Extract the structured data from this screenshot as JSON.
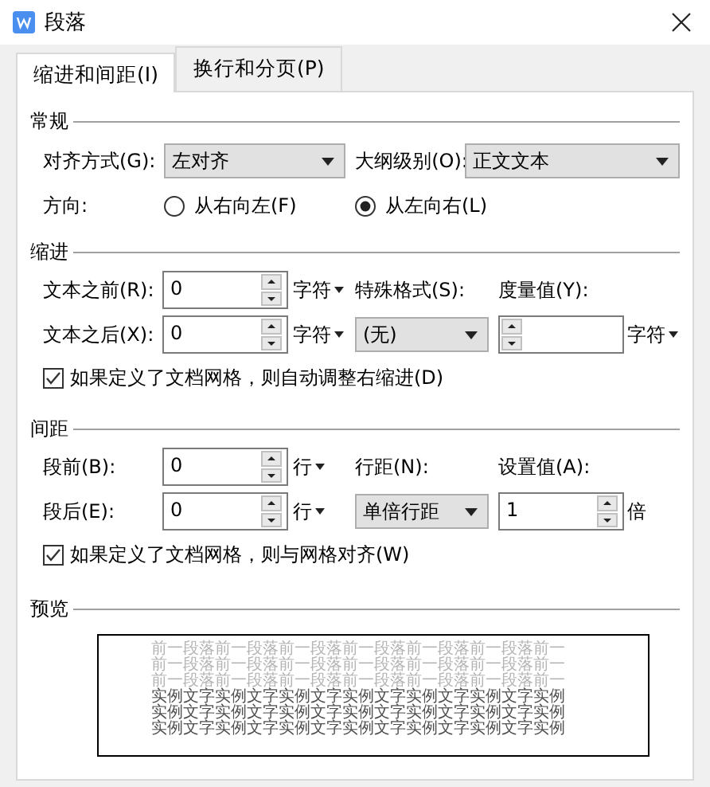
{
  "window": {
    "title": "段落"
  },
  "tabs": [
    {
      "label": "缩进和间距(I)",
      "selected": true
    },
    {
      "label": "换行和分页(P)",
      "selected": false
    }
  ],
  "general": {
    "heading": "常规",
    "alignment": {
      "label": "对齐方式(G):",
      "value": "左对齐"
    },
    "outline": {
      "label": "大纲级别(O):",
      "value": "正文文本"
    },
    "direction": {
      "label": "方向:",
      "options": [
        {
          "label": "从右向左(F)",
          "selected": false
        },
        {
          "label": "从左向右(L)",
          "selected": true
        }
      ]
    }
  },
  "indent": {
    "heading": "缩进",
    "before": {
      "label": "文本之前(R):",
      "value": "0",
      "unit": "字符"
    },
    "after": {
      "label": "文本之后(X):",
      "value": "0",
      "unit": "字符"
    },
    "special": {
      "label": "特殊格式(S):",
      "value": "(无)"
    },
    "measure": {
      "label": "度量值(Y):",
      "unit": "字符"
    },
    "checkbox": {
      "label": "如果定义了文档网格，则自动调整右缩进(D)",
      "checked": true
    }
  },
  "spacing": {
    "heading": "间距",
    "before": {
      "label": "段前(B):",
      "value": "0",
      "unit": "行"
    },
    "after": {
      "label": "段后(E):",
      "value": "0",
      "unit": "行"
    },
    "line": {
      "label": "行距(N):",
      "value": "单倍行距"
    },
    "setting": {
      "label": "设置值(A):",
      "value": "1",
      "unit": "倍"
    },
    "checkbox": {
      "label": "如果定义了文档网格，则与网格对齐(W)",
      "checked": true
    }
  },
  "preview": {
    "heading": "预览",
    "lines": [
      {
        "kind": "previous",
        "text": "前一段落前一段落前一段落前一段落前一段落前一段落前一"
      },
      {
        "kind": "previous",
        "text": "前一段落前一段落前一段落前一段落前一段落前一段落前一"
      },
      {
        "kind": "previous",
        "text": "前一段落前一段落前一段落前一段落前一段落前一段落前一"
      },
      {
        "kind": "sample",
        "text": "实例文字实例文字实例文字实例文字实例文字实例文字实例"
      },
      {
        "kind": "sample",
        "text": "实例文字实例文字实例文字实例文字实例文字实例文字实例"
      },
      {
        "kind": "sample",
        "text": "实例文字实例文字实例文字实例文字实例文字实例文字实例"
      }
    ]
  }
}
